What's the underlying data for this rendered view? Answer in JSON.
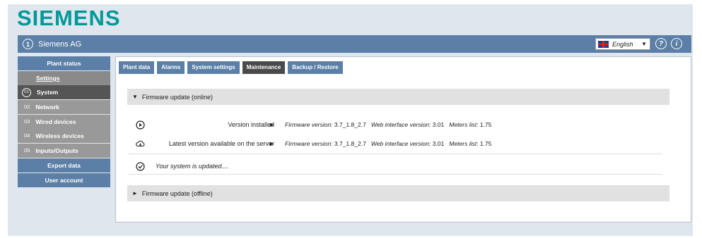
{
  "brand": {
    "logo_text": "SIEMENS"
  },
  "topbar": {
    "company": "Siemens AG",
    "language": "English"
  },
  "sidebar": {
    "items": [
      {
        "label": "Plant status"
      },
      {
        "label": "Settings"
      },
      {
        "num": "01",
        "label": "System"
      },
      {
        "num": "02",
        "label": "Network"
      },
      {
        "num": "03",
        "label": "Wired devices"
      },
      {
        "num": "04",
        "label": "Wireless devices"
      },
      {
        "num": "05",
        "label": "Inputs/Outputs"
      },
      {
        "label": "Export data"
      },
      {
        "label": "User account"
      }
    ]
  },
  "tabs": [
    "Plant data",
    "Alarms",
    "System settings",
    "Maintenance",
    "Backup / Restore"
  ],
  "online": {
    "title": "Firmware update (online)",
    "installed": {
      "label": "Version installed",
      "fw_label": "Firmware version:",
      "fw_value": "3.7_1.8_2.7",
      "web_label": "Web interface version:",
      "web_value": "3.01",
      "meters_label": "Meters list:",
      "meters_value": "1.75"
    },
    "latest": {
      "label": "Latest version available on the server",
      "fw_label": "Firmware version:",
      "fw_value": "3.7_1.8_2.7",
      "web_label": "Web interface version:",
      "web_value": "3.01",
      "meters_label": "Meters list:",
      "meters_value": "1.75"
    },
    "status": "Your system is updated...."
  },
  "offline": {
    "title": "Firmware update (offline)"
  }
}
